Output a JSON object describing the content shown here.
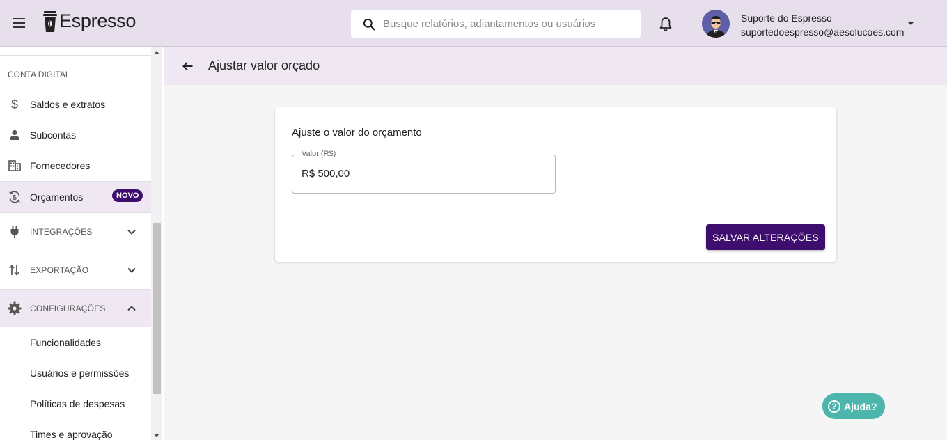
{
  "header": {
    "app_name": "Espresso",
    "search_placeholder": "Busque relatórios, adiantamentos ou usuários",
    "user_name": "Suporte do Espresso",
    "user_email": "suportedoespresso@aesolucoes.com"
  },
  "sidebar": {
    "section_title": "CONTA DIGITAL",
    "items": [
      {
        "label": "Saldos e extratos",
        "icon": "dollar-icon"
      },
      {
        "label": "Subcontas",
        "icon": "person-icon"
      },
      {
        "label": "Fornecedores",
        "icon": "building-icon"
      },
      {
        "label": "Orçamentos",
        "icon": "budget-icon",
        "badge": "NOVO"
      }
    ],
    "groups": [
      {
        "label": "INTEGRAÇÕES",
        "icon": "plug-icon",
        "expanded": false
      },
      {
        "label": "EXPORTAÇÃO",
        "icon": "sort-arrows-icon",
        "expanded": false
      },
      {
        "label": "CONFIGURAÇÕES",
        "icon": "gear-icon",
        "expanded": true
      }
    ],
    "sub_items": [
      {
        "label": "Funcionalidades"
      },
      {
        "label": "Usuários e permissões"
      },
      {
        "label": "Políticas de despesas"
      },
      {
        "label": "Times e aprovação"
      }
    ]
  },
  "page": {
    "title": "Ajustar valor orçado"
  },
  "card": {
    "title": "Ajuste o valor do orçamento",
    "field_label": "Valor (R$)",
    "field_value": "R$ 500,00",
    "save_label": "SALVAR ALTERAÇÕES"
  },
  "help": {
    "label": "Ajuda?"
  },
  "colors": {
    "header_bg": "#e7dfec",
    "accent": "#3e0e6e",
    "help": "#4db6ac"
  }
}
